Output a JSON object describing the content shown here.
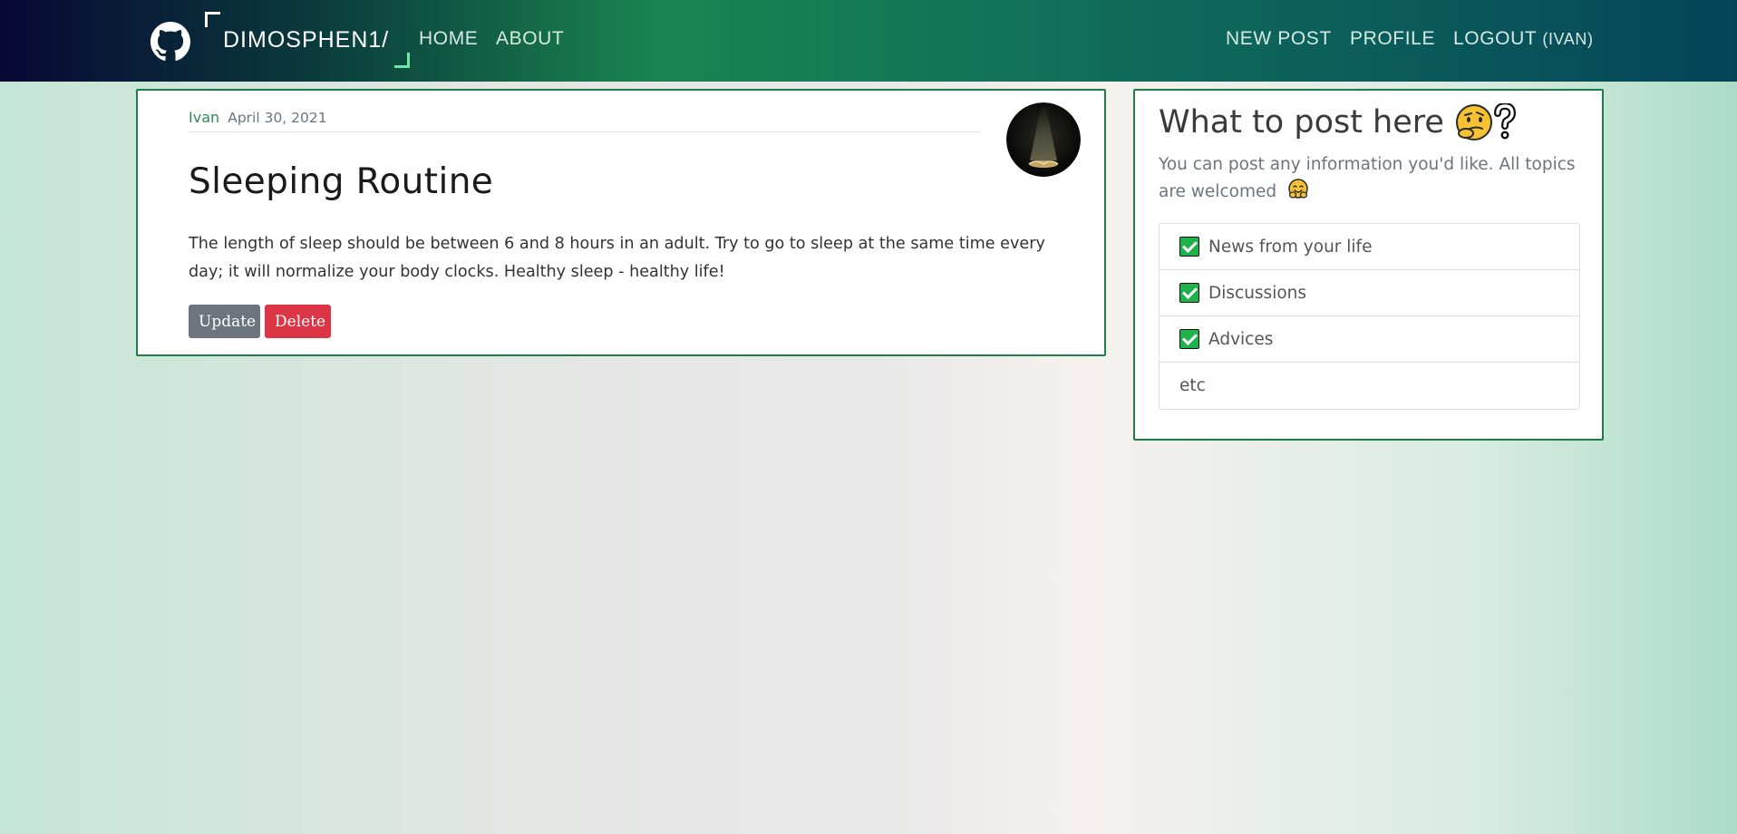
{
  "nav": {
    "brand": "DIMOSPHEN1/",
    "home": "HOME",
    "about": "ABOUT",
    "new_post": "NEW POST",
    "profile": "PROFILE",
    "logout": "LOGOUT",
    "logout_user": "(IVAN)",
    "logo_icon": "github-icon"
  },
  "post": {
    "author": "Ivan",
    "date": "April 30, 2021",
    "title": "Sleeping Routine",
    "body": "The length of sleep should be between 6 and 8 hours in an adult. Try to go to sleep at the same time every day; it will normalize your body clocks. Healthy sleep - healthy life!",
    "update_label": "Update",
    "delete_label": "Delete"
  },
  "sidebar": {
    "title": "What to post here",
    "description": "You can post any information you'd like. All topics are welcomed",
    "topics": [
      {
        "label": "News from your life",
        "checked": true
      },
      {
        "label": "Discussions",
        "checked": true
      },
      {
        "label": "Advices",
        "checked": true
      },
      {
        "label": "etc",
        "checked": false
      }
    ]
  },
  "colors": {
    "accent": "#1e7e48",
    "author_link": "#2e8b57",
    "update_button": "#6c757d",
    "delete_button": "#dc3545",
    "check_green": "#1fb24a"
  }
}
